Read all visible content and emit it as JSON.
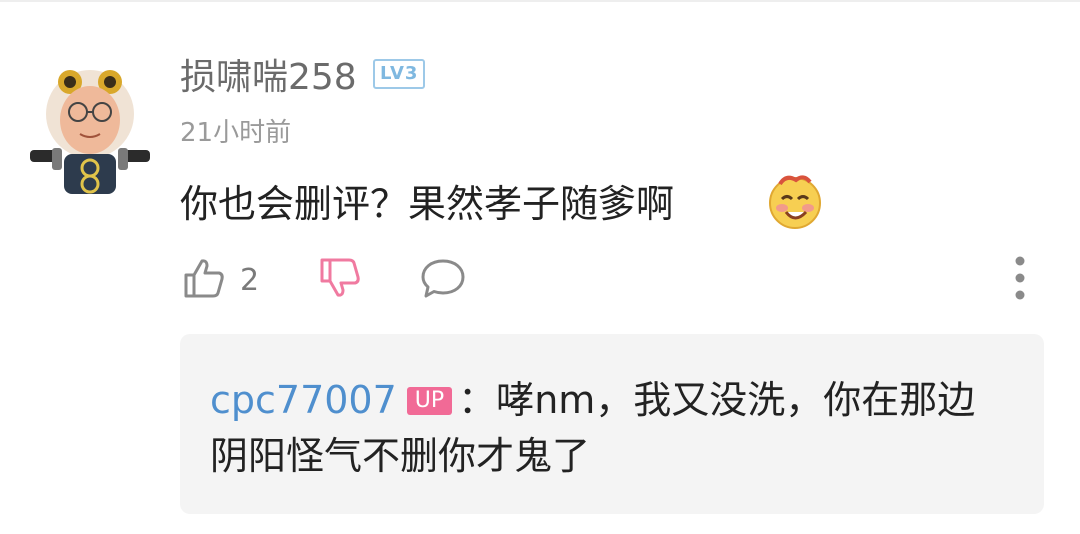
{
  "comment": {
    "username": "损啸喘258",
    "level": "LV3",
    "timestamp": "21小时前",
    "text": "你也会删评？果然孝子随爹啊",
    "emoji_icon": "emoji-blush-icon",
    "likes": "2"
  },
  "reply": {
    "username": "cpc77007",
    "badge": "UP",
    "separator": "：",
    "text": "哮nm，我又没洗，你在那边阴阳怪气不删你才鬼了"
  },
  "colors": {
    "username": "#6b6b6b",
    "reply_username": "#4f8fce",
    "up_badge": "#f16a96",
    "dislike_icon": "#f07aa0",
    "level_badge": "#7fb8e0",
    "reply_bg": "#f4f4f4"
  }
}
